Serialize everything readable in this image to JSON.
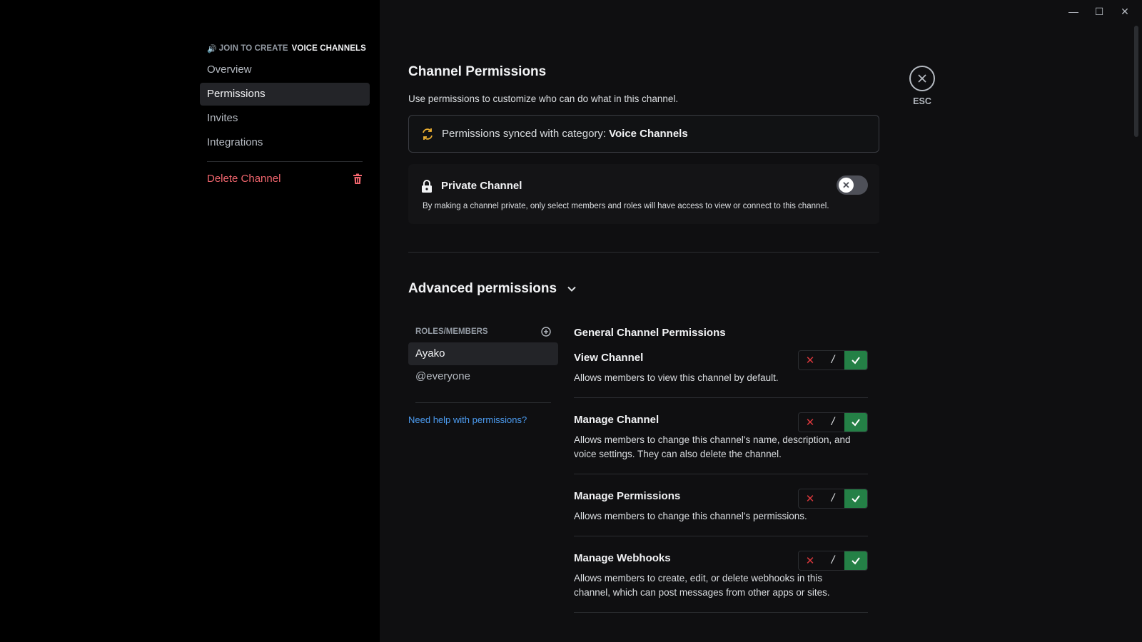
{
  "sidebar": {
    "header_prefix": "JOIN TO CREATE",
    "header_category": "VOICE CHANNELS",
    "items": [
      {
        "label": "Overview"
      },
      {
        "label": "Permissions"
      },
      {
        "label": "Invites"
      },
      {
        "label": "Integrations"
      }
    ],
    "delete_label": "Delete Channel"
  },
  "window_controls": {
    "minimize": "minimize-icon",
    "maximize": "maximize-icon",
    "close": "close-icon"
  },
  "main": {
    "title": "Channel Permissions",
    "description": "Use permissions to customize who can do what in this channel.",
    "sync_text": "Permissions synced with category:",
    "sync_category": "Voice Channels",
    "private": {
      "title": "Private Channel",
      "description": "By making a channel private, only select members and roles will have access to view or connect to this channel.",
      "enabled": false
    },
    "advanced_title": "Advanced permissions"
  },
  "roles": {
    "header": "ROLES/MEMBERS",
    "items": [
      {
        "label": "Ayako"
      },
      {
        "label": "@everyone"
      }
    ],
    "help_link": "Need help with permissions?"
  },
  "permissions": {
    "section_title": "General Channel Permissions",
    "items": [
      {
        "name": "View Channel",
        "description": "Allows members to view this channel by default.",
        "state": "allow"
      },
      {
        "name": "Manage Channel",
        "description": "Allows members to change this channel's name, description, and voice settings. They can also delete the channel.",
        "state": "allow"
      },
      {
        "name": "Manage Permissions",
        "description": "Allows members to change this channel's permissions.",
        "state": "allow"
      },
      {
        "name": "Manage Webhooks",
        "description": "Allows members to create, edit, or delete webhooks in this channel, which can post messages from other apps or sites.",
        "state": "allow"
      }
    ],
    "neutral_symbol": "/"
  },
  "close": {
    "label": "ESC"
  },
  "colors": {
    "accent_allow": "#248046",
    "deny": "#da373c",
    "danger": "#f0656d",
    "link": "#4c9cf1",
    "sync_icon": "#f0b232"
  }
}
